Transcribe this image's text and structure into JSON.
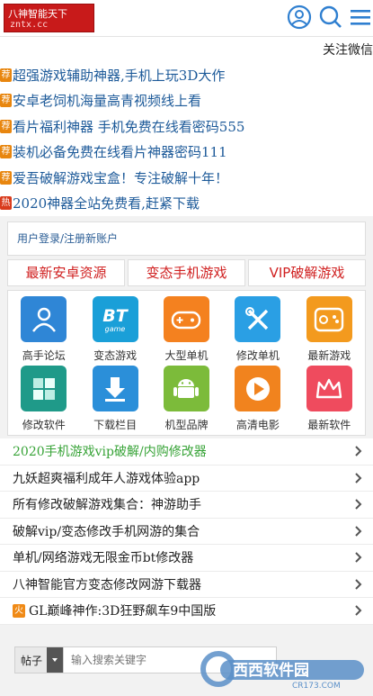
{
  "header": {
    "logo_title": "八神智能天下",
    "logo_domain": "zntx.cc",
    "profile_icon": "user-circle-icon",
    "search_icon": "search-icon",
    "menu_icon": "menu-icon"
  },
  "marquee": {
    "text": "关注微信"
  },
  "ads": [
    {
      "tag": "荐",
      "text": "超强游戏辅助神器,手机上玩3D大作"
    },
    {
      "tag": "荐",
      "text": "安卓老饲机海量高青视频线上看"
    },
    {
      "tag": "荐",
      "text": "看片福利神器 手机免费在线看密码555"
    },
    {
      "tag": "荐",
      "text": "装机必备免费在线看片神器密码111"
    },
    {
      "tag": "荐",
      "text": "爱吾破解游戏宝盒！专注破解十年！"
    },
    {
      "tag": "热",
      "text": "2020神器全站免费看,赶紧下载"
    }
  ],
  "login": {
    "text": "用户登录/注册新账户"
  },
  "tabs": [
    "最新安卓资源",
    "变态手机游戏",
    "VIP破解游戏"
  ],
  "grid": [
    {
      "label": "高手论坛",
      "icon": "users-icon",
      "color": "#2f86d6"
    },
    {
      "label": "变态游戏",
      "icon": "bt-game-icon",
      "color": "#1a9fd8"
    },
    {
      "label": "大型单机",
      "icon": "gamepad-icon",
      "color": "#f4811f"
    },
    {
      "label": "修改单机",
      "icon": "tools-icon",
      "color": "#2a9fe4"
    },
    {
      "label": "最新游戏",
      "icon": "controller-icon",
      "color": "#f39a1e"
    },
    {
      "label": "修改软件",
      "icon": "cubes-icon",
      "color": "#1f9a89"
    },
    {
      "label": "下载栏目",
      "icon": "download-icon",
      "color": "#2b8fd9"
    },
    {
      "label": "机型品牌",
      "icon": "android-icon",
      "color": "#7cbb3a"
    },
    {
      "label": "高清电影",
      "icon": "play-icon",
      "color": "#f1831e"
    },
    {
      "label": "最新软件",
      "icon": "crown-icon",
      "color": "#ef4b5e"
    }
  ],
  "list": [
    {
      "text": "2020手机游戏vip破解/内购修改器",
      "green": true
    },
    {
      "text": "九妖超爽福利成年人游戏体验app"
    },
    {
      "text": "所有修改破解游戏集合：神游助手"
    },
    {
      "text": "破解vip/变态修改手机网游的集合"
    },
    {
      "text": "单机/网络游戏无限金币bt修改器"
    },
    {
      "text": "八神智能官方变态修改网游下载器"
    },
    {
      "text": "GL巅峰神作:3D狂野飙车9中国版",
      "fire": "火"
    }
  ],
  "search": {
    "select_label": "帖子",
    "placeholder": "输入搜索关键字"
  },
  "watermark": {
    "text": "西西软件园",
    "domain": "CR173.COM"
  }
}
